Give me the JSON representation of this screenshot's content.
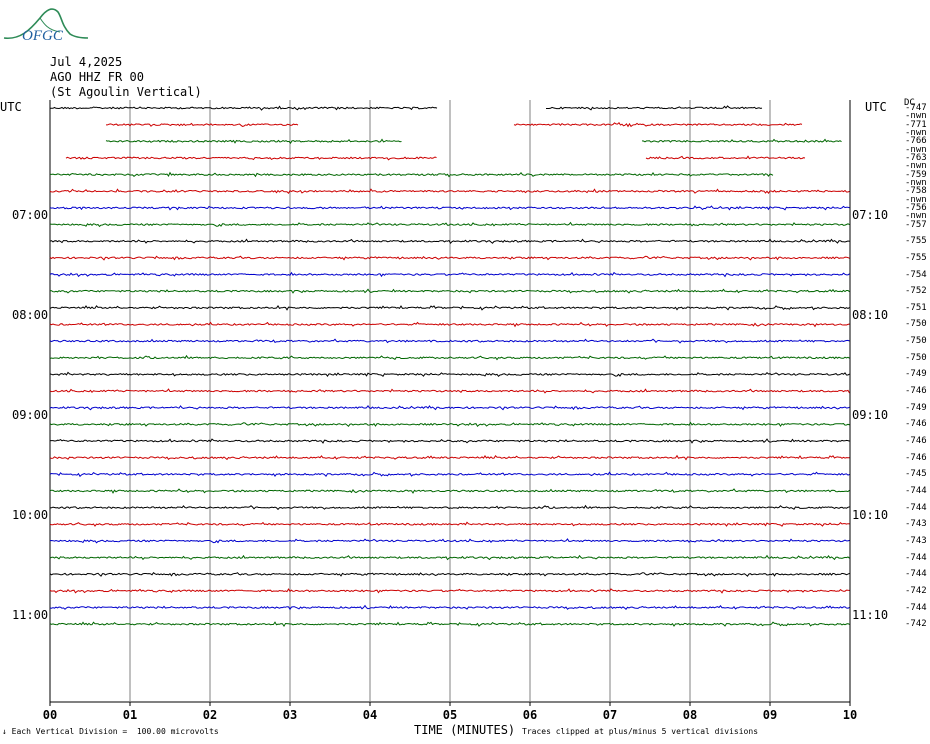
{
  "logo": {
    "text": "OFGC"
  },
  "header": {
    "date": "Jul 4,2025",
    "station": "AGO HHZ FR 00",
    "location": "(St Agoulin Vertical)"
  },
  "utc_label_left": "UTC",
  "utc_label_right": "UTC",
  "dc_label": "DC",
  "footer": {
    "scale_text": "Each Vertical Division =  100.00 microvolts",
    "xlabel": "TIME (MINUTES)",
    "clip_text": "Traces clipped at plus/minus 5 vertical divisions"
  },
  "colors": {
    "black": "#000000",
    "red": "#cc0000",
    "blue": "#0000cc",
    "green": "#006600",
    "grid": "#808080",
    "logo": "#2e8b57"
  },
  "chart_data": {
    "type": "line",
    "title": "AGO HHZ FR 00 (St Agoulin Vertical)",
    "xlabel": "TIME (MINUTES)",
    "xlim": [
      0,
      10
    ],
    "x_ticks": [
      "00",
      "01",
      "02",
      "03",
      "04",
      "05",
      "06",
      "07",
      "08",
      "09",
      "10"
    ],
    "grid": "vertical lines each minute",
    "left_time_labels": [
      {
        "row": 6.5,
        "label": "07:00"
      },
      {
        "row": 12.5,
        "label": "08:00"
      },
      {
        "row": 18.5,
        "label": "09:00"
      },
      {
        "row": 24.5,
        "label": "10:00"
      },
      {
        "row": 30.5,
        "label": "11:00"
      }
    ],
    "right_time_labels": [
      {
        "row": 6.5,
        "label": "07:10"
      },
      {
        "row": 12.5,
        "label": "08:10"
      },
      {
        "row": 18.5,
        "label": "09:10"
      },
      {
        "row": 24.5,
        "label": "10:10"
      },
      {
        "row": 30.5,
        "label": "11:10"
      }
    ],
    "color_cycle": [
      "black",
      "red",
      "blue",
      "green"
    ],
    "traces": [
      {
        "row": 0,
        "color": "black",
        "dc": "-747",
        "segments": [
          [
            0,
            4.85
          ],
          [
            6.2,
            8.9
          ]
        ]
      },
      {
        "row": 1,
        "color": "red",
        "dc": "-771",
        "segments": [
          [
            0.7,
            3.1
          ],
          [
            5.8,
            9.4
          ]
        ]
      },
      {
        "row": 2,
        "color": "green",
        "dc": "-766",
        "segments": [
          [
            0.7,
            4.4
          ],
          [
            7.4,
            9.9
          ]
        ]
      },
      {
        "row": 3,
        "color": "red",
        "dc": "-763",
        "segments": [
          [
            0.2,
            4.85
          ],
          [
            7.45,
            9.45
          ]
        ]
      },
      {
        "row": 4,
        "color": "green",
        "dc": "-759",
        "segments": [
          [
            0,
            9.05
          ]
        ]
      },
      {
        "row": 5,
        "color": "red",
        "dc": "-758",
        "segments": [
          [
            0,
            10
          ]
        ]
      },
      {
        "row": 6,
        "color": "blue",
        "dc": "-756",
        "segments": [
          [
            0,
            10
          ]
        ]
      },
      {
        "row": 7,
        "color": "green",
        "dc": "-757",
        "segments": [
          [
            0,
            10
          ]
        ]
      },
      {
        "row": 8,
        "color": "black",
        "dc": "-755",
        "segments": [
          [
            0,
            10
          ]
        ]
      },
      {
        "row": 9,
        "color": "red",
        "dc": "-755",
        "segments": [
          [
            0,
            10
          ]
        ]
      },
      {
        "row": 10,
        "color": "blue",
        "dc": "-754",
        "segments": [
          [
            0,
            10
          ]
        ]
      },
      {
        "row": 11,
        "color": "green",
        "dc": "-752",
        "segments": [
          [
            0,
            10
          ]
        ]
      },
      {
        "row": 12,
        "color": "black",
        "dc": "-751",
        "segments": [
          [
            0,
            10
          ]
        ]
      },
      {
        "row": 13,
        "color": "red",
        "dc": "-750",
        "segments": [
          [
            0,
            10
          ]
        ]
      },
      {
        "row": 14,
        "color": "blue",
        "dc": "-750",
        "segments": [
          [
            0,
            10
          ]
        ]
      },
      {
        "row": 15,
        "color": "green",
        "dc": "-750",
        "segments": [
          [
            0,
            10
          ]
        ]
      },
      {
        "row": 16,
        "color": "black",
        "dc": "-749",
        "segments": [
          [
            0,
            10
          ]
        ]
      },
      {
        "row": 17,
        "color": "red",
        "dc": "-746",
        "segments": [
          [
            0,
            10
          ]
        ]
      },
      {
        "row": 18,
        "color": "blue",
        "dc": "-749",
        "segments": [
          [
            0,
            10
          ]
        ]
      },
      {
        "row": 19,
        "color": "green",
        "dc": "-746",
        "segments": [
          [
            0,
            10
          ]
        ]
      },
      {
        "row": 20,
        "color": "black",
        "dc": "-746",
        "segments": [
          [
            0,
            10
          ]
        ]
      },
      {
        "row": 21,
        "color": "red",
        "dc": "-746",
        "segments": [
          [
            0,
            10
          ]
        ]
      },
      {
        "row": 22,
        "color": "blue",
        "dc": "-745",
        "segments": [
          [
            0,
            10
          ]
        ]
      },
      {
        "row": 23,
        "color": "green",
        "dc": "-744",
        "segments": [
          [
            0,
            10
          ]
        ]
      },
      {
        "row": 24,
        "color": "black",
        "dc": "-744",
        "segments": [
          [
            0,
            10
          ]
        ]
      },
      {
        "row": 25,
        "color": "red",
        "dc": "-743",
        "segments": [
          [
            0,
            10
          ]
        ]
      },
      {
        "row": 26,
        "color": "blue",
        "dc": "-743",
        "segments": [
          [
            0,
            10
          ]
        ]
      },
      {
        "row": 27,
        "color": "green",
        "dc": "-744",
        "segments": [
          [
            0,
            10
          ]
        ]
      },
      {
        "row": 28,
        "color": "black",
        "dc": "-744",
        "segments": [
          [
            0,
            10
          ]
        ]
      },
      {
        "row": 29,
        "color": "red",
        "dc": "-742",
        "segments": [
          [
            0,
            10
          ]
        ]
      },
      {
        "row": 30,
        "color": "blue",
        "dc": "-744",
        "segments": [
          [
            0,
            10
          ]
        ]
      },
      {
        "row": 31,
        "color": "green",
        "dc": "-742",
        "segments": [
          [
            0,
            10
          ]
        ]
      }
    ],
    "blank_dc_marks": "-nwn"
  }
}
